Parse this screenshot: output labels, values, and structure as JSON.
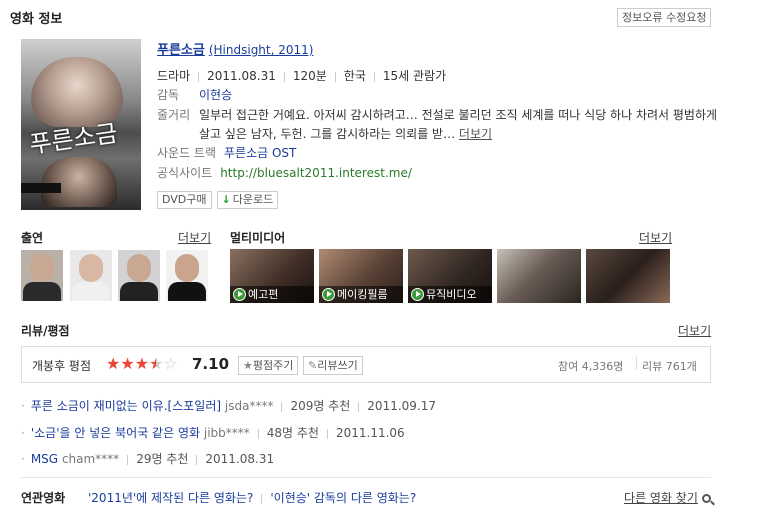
{
  "header": {
    "title": "영화 정보",
    "report_button": "정보오류 수정요청"
  },
  "movie": {
    "title_ko": "푸른소금",
    "title_en": "(Hindsight, 2011)",
    "poster_text": "푸른소금",
    "genre": "드라마",
    "release_date": "2011.08.31",
    "runtime": "120분",
    "country": "한국",
    "rating": "15세 관람가",
    "director_label": "감독",
    "director": "이현승",
    "plot_label": "줄거리",
    "plot_line1": "일부러 접근한 거예요. 아저씨 감시하려고… 전설로 불리던 조직 세계를 떠나 식당 하나 차려서 평범하게",
    "plot_line2": "살고 싶은 남자, 두헌. 그를 감시하라는 의뢰를 받…",
    "plot_more": "더보기",
    "soundtrack_label": "사운드 트랙",
    "soundtrack": "푸른소금 OST",
    "site_label": "공식사이트",
    "site": "http://bluesalt2011.interest.me/",
    "dvd_button": "DVD구매",
    "download_button": "다운로드"
  },
  "cast": {
    "title": "출연",
    "more": "더보기",
    "count": 4
  },
  "multimedia": {
    "title": "멀티미디어",
    "more": "더보기",
    "items": [
      {
        "caption": "예고편"
      },
      {
        "caption": "메이킹필름"
      },
      {
        "caption": "뮤직비디오"
      },
      {
        "caption": ""
      },
      {
        "caption": ""
      }
    ]
  },
  "reviews": {
    "title": "리뷰/평점",
    "more": "더보기",
    "rating_label": "개봉후 평점",
    "score": "7.10",
    "stars_value": 3.5,
    "rate_button": "평점주기",
    "review_button": "리뷰쓰기",
    "participants": "참여 4,336명",
    "review_count": "리뷰 761개",
    "items": [
      {
        "title": "푸른 소금이 재미없는 이유.[스포일러]",
        "user": "jsda****",
        "rec": "209명 추천",
        "date": "2011.09.17"
      },
      {
        "title": "'소금'을 안 넣은 북어국 같은 영화",
        "user": "jibb****",
        "rec": "48명 추천",
        "date": "2011.11.06"
      },
      {
        "title": "MSG",
        "user": "cham****",
        "rec": "29명 추천",
        "date": "2011.08.31"
      }
    ]
  },
  "related": {
    "title": "연관영화",
    "link1": "'2011년'에 제작된 다른 영화는?",
    "link2": "'이현승' 감독의 다른 영화는?",
    "find": "다른 영화 찾기"
  },
  "colors": {
    "link": "#1a3c9c",
    "green": "#2a7a2a",
    "star": "#e43"
  }
}
